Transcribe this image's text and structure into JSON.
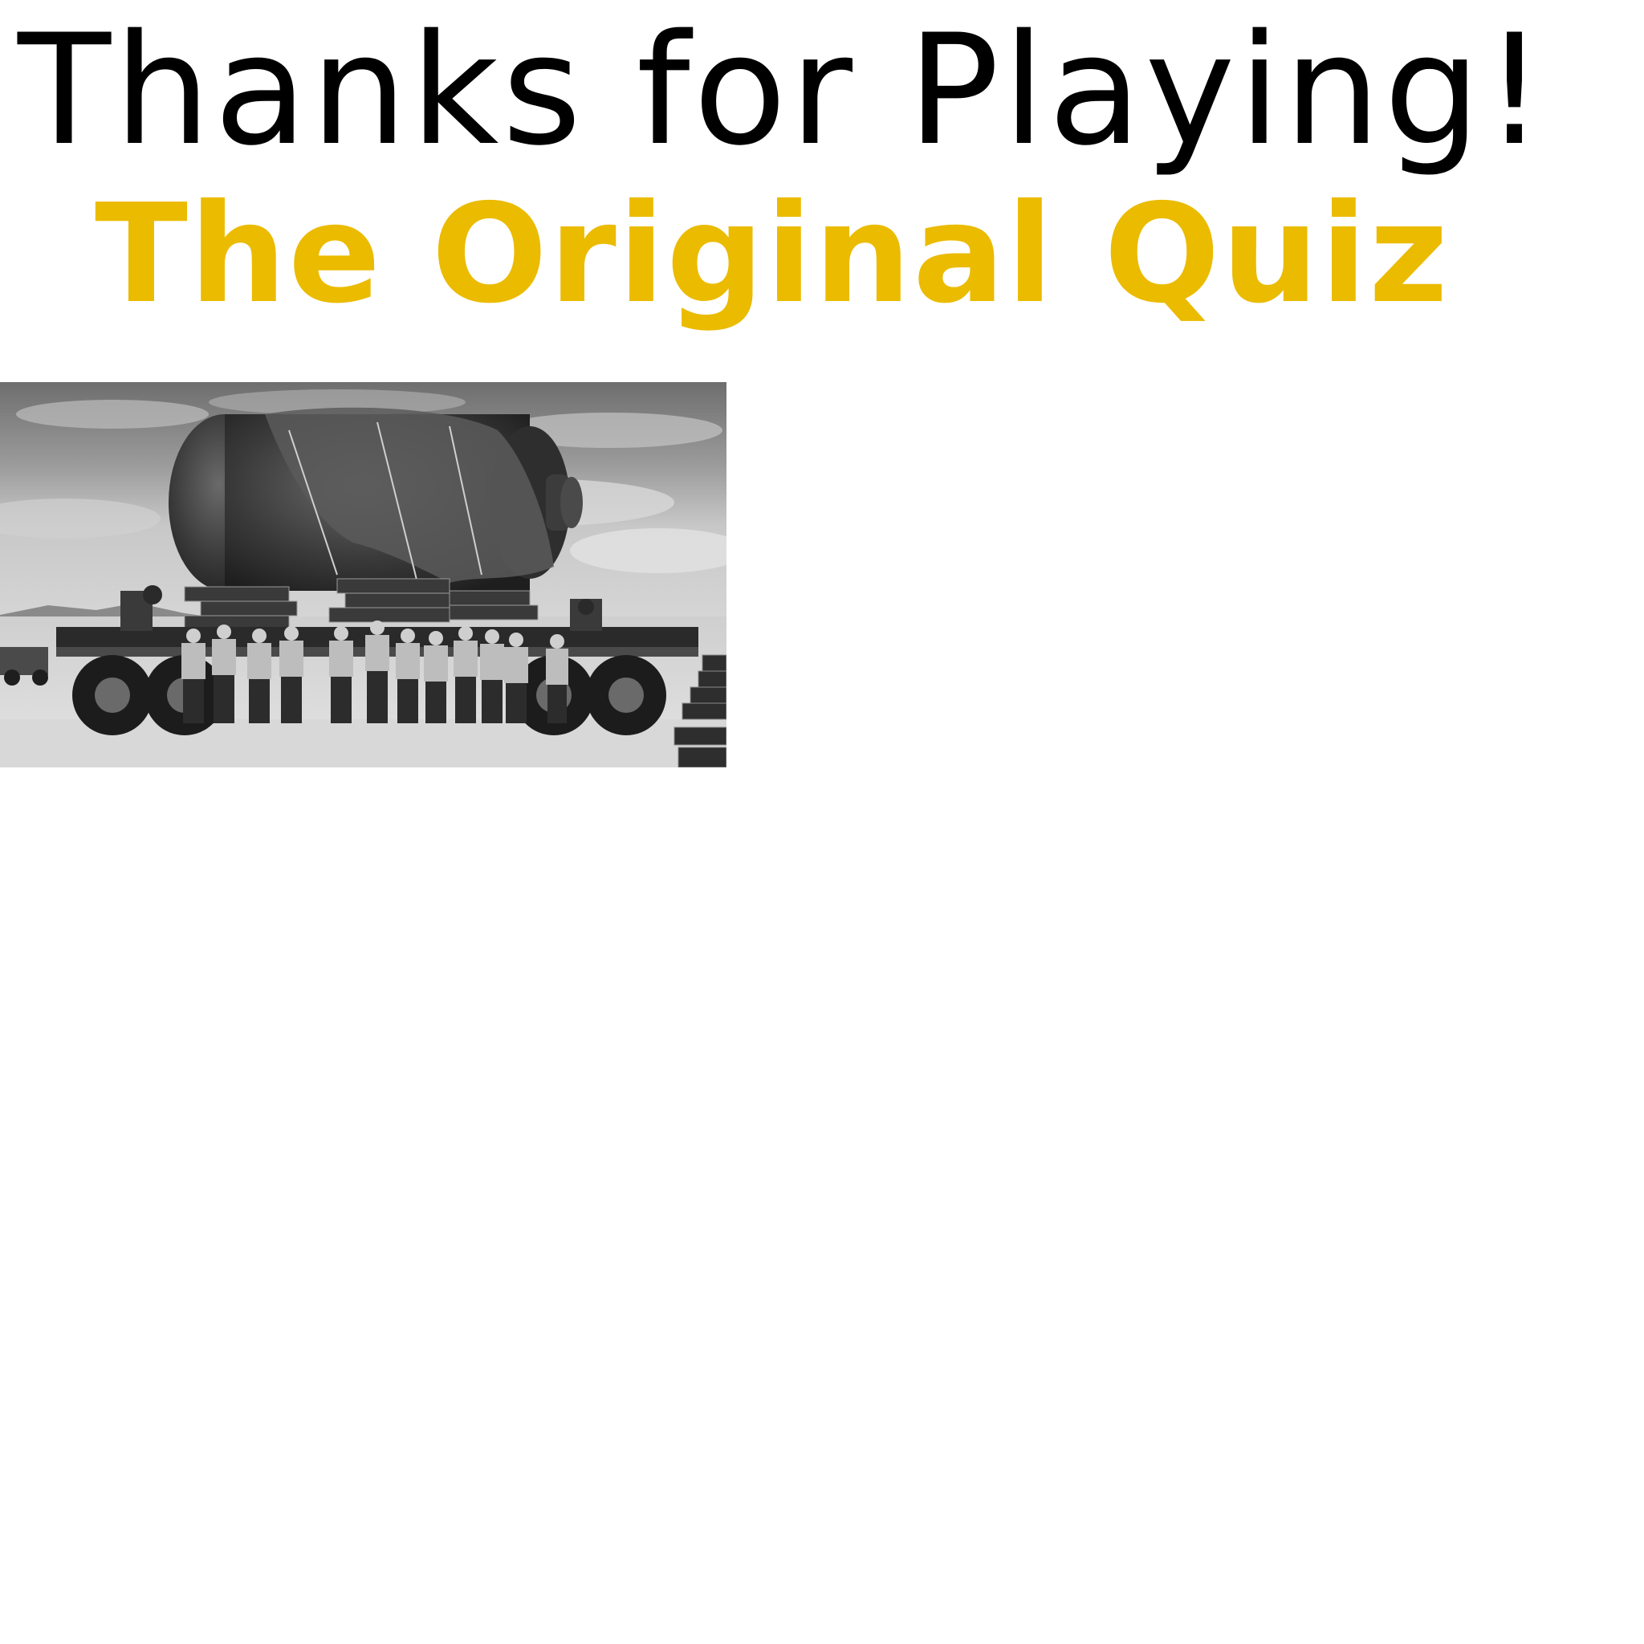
{
  "heading": {
    "thanks_text": "Thanks for Playing!"
  },
  "quiz_link": {
    "label": "The Original Quiz",
    "color": "#EBBB00"
  },
  "photo": {
    "icon": "historic-photo-bw"
  }
}
